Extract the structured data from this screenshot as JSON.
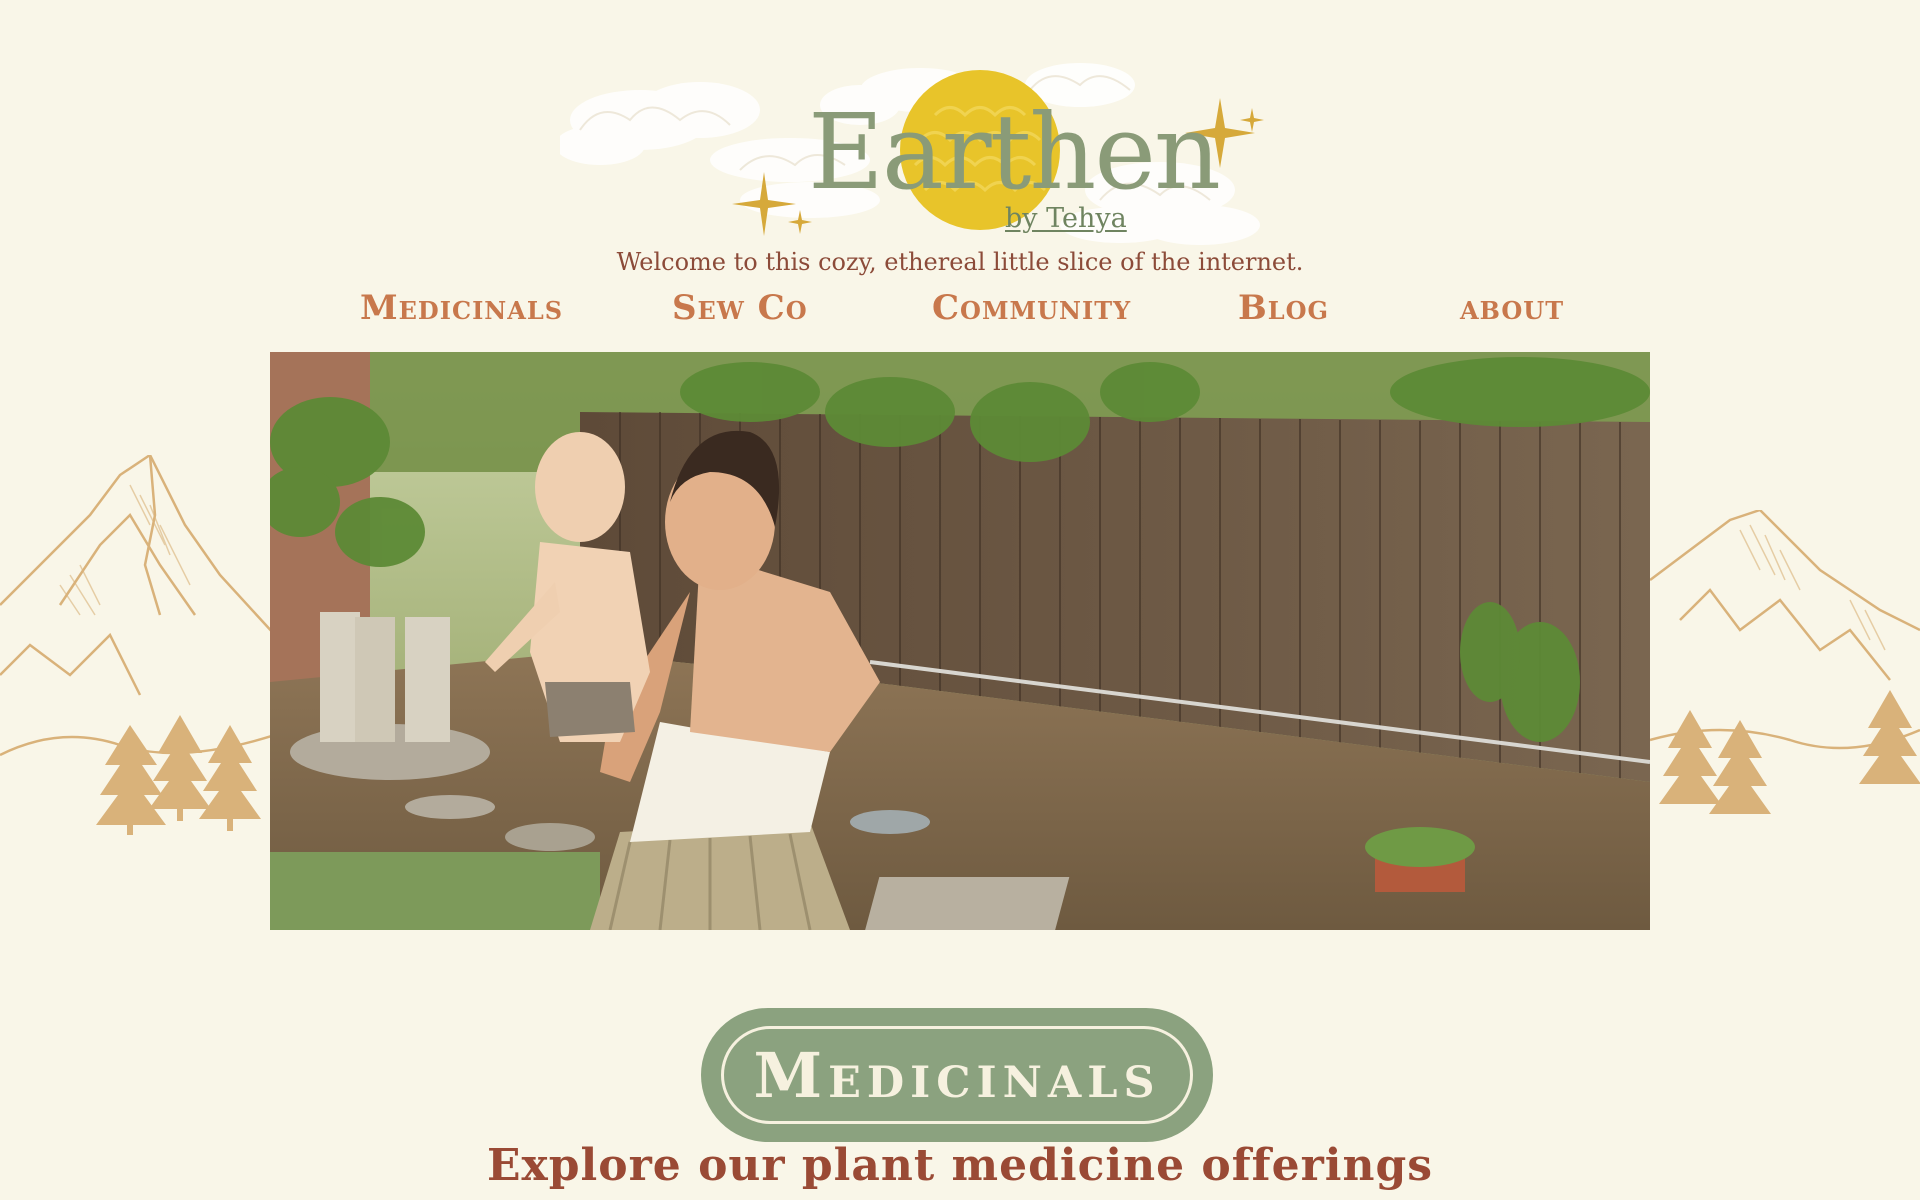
{
  "header": {
    "logo_title": "Earthen",
    "logo_subtitle": "by Tehya",
    "tagline": "Welcome to this cozy, ethereal little slice of the internet."
  },
  "nav": {
    "items": [
      {
        "label": "Medicinals"
      },
      {
        "label": "Sew Co"
      },
      {
        "label": "Community"
      },
      {
        "label": "Blog"
      },
      {
        "label": "about"
      }
    ]
  },
  "hero": {
    "icon": "backyard-photo"
  },
  "section": {
    "button_label": "Medicinals",
    "heading": "Explore our plant medicine offerings"
  },
  "colors": {
    "background": "#f9f6e8",
    "logo_green": "#8a9b78",
    "sun_yellow": "#e8c42a",
    "nav_orange": "#c8784c",
    "heading_rust": "#9a4a35",
    "button_green": "#8ba27f",
    "mountain_tan": "#d9b27a"
  }
}
